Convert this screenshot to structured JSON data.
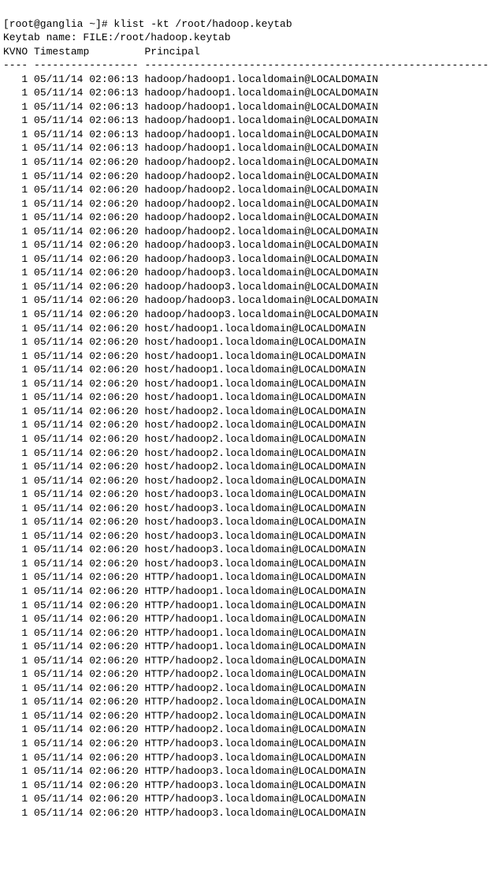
{
  "prompt": {
    "full": "[root@ganglia ~]# klist -kt /root/hadoop.keytab"
  },
  "keytab": {
    "label": "Keytab name: ",
    "value": "FILE:/root/hadoop.keytab"
  },
  "headers": {
    "kvno": "KVNO",
    "timestamp": "Timestamp",
    "principal": "Principal"
  },
  "sep": {
    "kvno": "----",
    "timestamp": "-----------------",
    "principal": "--------------------------------------------------------"
  },
  "entries": [
    {
      "kvno": "1",
      "timestamp": "05/11/14 02:06:13",
      "principal": "hadoop/hadoop1.localdomain@LOCALDOMAIN"
    },
    {
      "kvno": "1",
      "timestamp": "05/11/14 02:06:13",
      "principal": "hadoop/hadoop1.localdomain@LOCALDOMAIN"
    },
    {
      "kvno": "1",
      "timestamp": "05/11/14 02:06:13",
      "principal": "hadoop/hadoop1.localdomain@LOCALDOMAIN"
    },
    {
      "kvno": "1",
      "timestamp": "05/11/14 02:06:13",
      "principal": "hadoop/hadoop1.localdomain@LOCALDOMAIN"
    },
    {
      "kvno": "1",
      "timestamp": "05/11/14 02:06:13",
      "principal": "hadoop/hadoop1.localdomain@LOCALDOMAIN"
    },
    {
      "kvno": "1",
      "timestamp": "05/11/14 02:06:13",
      "principal": "hadoop/hadoop1.localdomain@LOCALDOMAIN"
    },
    {
      "kvno": "1",
      "timestamp": "05/11/14 02:06:20",
      "principal": "hadoop/hadoop2.localdomain@LOCALDOMAIN"
    },
    {
      "kvno": "1",
      "timestamp": "05/11/14 02:06:20",
      "principal": "hadoop/hadoop2.localdomain@LOCALDOMAIN"
    },
    {
      "kvno": "1",
      "timestamp": "05/11/14 02:06:20",
      "principal": "hadoop/hadoop2.localdomain@LOCALDOMAIN"
    },
    {
      "kvno": "1",
      "timestamp": "05/11/14 02:06:20",
      "principal": "hadoop/hadoop2.localdomain@LOCALDOMAIN"
    },
    {
      "kvno": "1",
      "timestamp": "05/11/14 02:06:20",
      "principal": "hadoop/hadoop2.localdomain@LOCALDOMAIN"
    },
    {
      "kvno": "1",
      "timestamp": "05/11/14 02:06:20",
      "principal": "hadoop/hadoop2.localdomain@LOCALDOMAIN"
    },
    {
      "kvno": "1",
      "timestamp": "05/11/14 02:06:20",
      "principal": "hadoop/hadoop3.localdomain@LOCALDOMAIN"
    },
    {
      "kvno": "1",
      "timestamp": "05/11/14 02:06:20",
      "principal": "hadoop/hadoop3.localdomain@LOCALDOMAIN"
    },
    {
      "kvno": "1",
      "timestamp": "05/11/14 02:06:20",
      "principal": "hadoop/hadoop3.localdomain@LOCALDOMAIN"
    },
    {
      "kvno": "1",
      "timestamp": "05/11/14 02:06:20",
      "principal": "hadoop/hadoop3.localdomain@LOCALDOMAIN"
    },
    {
      "kvno": "1",
      "timestamp": "05/11/14 02:06:20",
      "principal": "hadoop/hadoop3.localdomain@LOCALDOMAIN"
    },
    {
      "kvno": "1",
      "timestamp": "05/11/14 02:06:20",
      "principal": "hadoop/hadoop3.localdomain@LOCALDOMAIN"
    },
    {
      "kvno": "1",
      "timestamp": "05/11/14 02:06:20",
      "principal": "host/hadoop1.localdomain@LOCALDOMAIN"
    },
    {
      "kvno": "1",
      "timestamp": "05/11/14 02:06:20",
      "principal": "host/hadoop1.localdomain@LOCALDOMAIN"
    },
    {
      "kvno": "1",
      "timestamp": "05/11/14 02:06:20",
      "principal": "host/hadoop1.localdomain@LOCALDOMAIN"
    },
    {
      "kvno": "1",
      "timestamp": "05/11/14 02:06:20",
      "principal": "host/hadoop1.localdomain@LOCALDOMAIN"
    },
    {
      "kvno": "1",
      "timestamp": "05/11/14 02:06:20",
      "principal": "host/hadoop1.localdomain@LOCALDOMAIN"
    },
    {
      "kvno": "1",
      "timestamp": "05/11/14 02:06:20",
      "principal": "host/hadoop1.localdomain@LOCALDOMAIN"
    },
    {
      "kvno": "1",
      "timestamp": "05/11/14 02:06:20",
      "principal": "host/hadoop2.localdomain@LOCALDOMAIN"
    },
    {
      "kvno": "1",
      "timestamp": "05/11/14 02:06:20",
      "principal": "host/hadoop2.localdomain@LOCALDOMAIN"
    },
    {
      "kvno": "1",
      "timestamp": "05/11/14 02:06:20",
      "principal": "host/hadoop2.localdomain@LOCALDOMAIN"
    },
    {
      "kvno": "1",
      "timestamp": "05/11/14 02:06:20",
      "principal": "host/hadoop2.localdomain@LOCALDOMAIN"
    },
    {
      "kvno": "1",
      "timestamp": "05/11/14 02:06:20",
      "principal": "host/hadoop2.localdomain@LOCALDOMAIN"
    },
    {
      "kvno": "1",
      "timestamp": "05/11/14 02:06:20",
      "principal": "host/hadoop2.localdomain@LOCALDOMAIN"
    },
    {
      "kvno": "1",
      "timestamp": "05/11/14 02:06:20",
      "principal": "host/hadoop3.localdomain@LOCALDOMAIN"
    },
    {
      "kvno": "1",
      "timestamp": "05/11/14 02:06:20",
      "principal": "host/hadoop3.localdomain@LOCALDOMAIN"
    },
    {
      "kvno": "1",
      "timestamp": "05/11/14 02:06:20",
      "principal": "host/hadoop3.localdomain@LOCALDOMAIN"
    },
    {
      "kvno": "1",
      "timestamp": "05/11/14 02:06:20",
      "principal": "host/hadoop3.localdomain@LOCALDOMAIN"
    },
    {
      "kvno": "1",
      "timestamp": "05/11/14 02:06:20",
      "principal": "host/hadoop3.localdomain@LOCALDOMAIN"
    },
    {
      "kvno": "1",
      "timestamp": "05/11/14 02:06:20",
      "principal": "host/hadoop3.localdomain@LOCALDOMAIN"
    },
    {
      "kvno": "1",
      "timestamp": "05/11/14 02:06:20",
      "principal": "HTTP/hadoop1.localdomain@LOCALDOMAIN"
    },
    {
      "kvno": "1",
      "timestamp": "05/11/14 02:06:20",
      "principal": "HTTP/hadoop1.localdomain@LOCALDOMAIN"
    },
    {
      "kvno": "1",
      "timestamp": "05/11/14 02:06:20",
      "principal": "HTTP/hadoop1.localdomain@LOCALDOMAIN"
    },
    {
      "kvno": "1",
      "timestamp": "05/11/14 02:06:20",
      "principal": "HTTP/hadoop1.localdomain@LOCALDOMAIN"
    },
    {
      "kvno": "1",
      "timestamp": "05/11/14 02:06:20",
      "principal": "HTTP/hadoop1.localdomain@LOCALDOMAIN"
    },
    {
      "kvno": "1",
      "timestamp": "05/11/14 02:06:20",
      "principal": "HTTP/hadoop1.localdomain@LOCALDOMAIN"
    },
    {
      "kvno": "1",
      "timestamp": "05/11/14 02:06:20",
      "principal": "HTTP/hadoop2.localdomain@LOCALDOMAIN"
    },
    {
      "kvno": "1",
      "timestamp": "05/11/14 02:06:20",
      "principal": "HTTP/hadoop2.localdomain@LOCALDOMAIN"
    },
    {
      "kvno": "1",
      "timestamp": "05/11/14 02:06:20",
      "principal": "HTTP/hadoop2.localdomain@LOCALDOMAIN"
    },
    {
      "kvno": "1",
      "timestamp": "05/11/14 02:06:20",
      "principal": "HTTP/hadoop2.localdomain@LOCALDOMAIN"
    },
    {
      "kvno": "1",
      "timestamp": "05/11/14 02:06:20",
      "principal": "HTTP/hadoop2.localdomain@LOCALDOMAIN"
    },
    {
      "kvno": "1",
      "timestamp": "05/11/14 02:06:20",
      "principal": "HTTP/hadoop2.localdomain@LOCALDOMAIN"
    },
    {
      "kvno": "1",
      "timestamp": "05/11/14 02:06:20",
      "principal": "HTTP/hadoop3.localdomain@LOCALDOMAIN"
    },
    {
      "kvno": "1",
      "timestamp": "05/11/14 02:06:20",
      "principal": "HTTP/hadoop3.localdomain@LOCALDOMAIN"
    },
    {
      "kvno": "1",
      "timestamp": "05/11/14 02:06:20",
      "principal": "HTTP/hadoop3.localdomain@LOCALDOMAIN"
    },
    {
      "kvno": "1",
      "timestamp": "05/11/14 02:06:20",
      "principal": "HTTP/hadoop3.localdomain@LOCALDOMAIN"
    },
    {
      "kvno": "1",
      "timestamp": "05/11/14 02:06:20",
      "principal": "HTTP/hadoop3.localdomain@LOCALDOMAIN"
    },
    {
      "kvno": "1",
      "timestamp": "05/11/14 02:06:20",
      "principal": "HTTP/hadoop3.localdomain@LOCALDOMAIN"
    }
  ]
}
